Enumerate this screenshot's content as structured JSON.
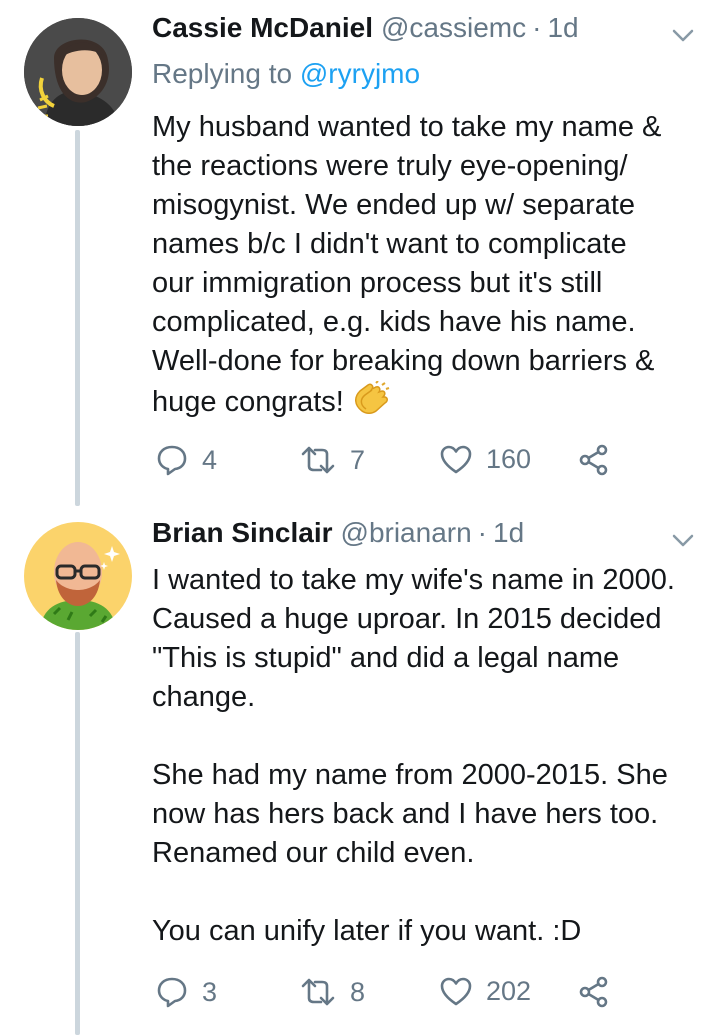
{
  "tweets": [
    {
      "name": "Cassie McDaniel",
      "handle": "@cassiemc",
      "separator": "·",
      "age": "1d",
      "replying_prefix": "Replying to",
      "replying_to": "@ryryjmo",
      "body": "My husband wanted to take my name &\nthe reactions were truly eye-opening/\nmisogynist. We ended up w/ separate\nnames b/c I didn't want to complicate\nour immigration process but it's still\ncomplicated, e.g. kids have his name.\nWell-done for breaking down barriers &\nhuge congrats!",
      "emoji": "clapping-hands-emoji",
      "replies": "4",
      "retweets": "7",
      "likes": "160"
    },
    {
      "name": "Brian Sinclair",
      "handle": "@brianarn",
      "separator": "·",
      "age": "1d",
      "body": "I wanted to take my wife's name in 2000.\nCaused a huge uproar. In 2015 decided\n\"This is stupid\" and did a legal name\nchange.\n\nShe had my name from 2000-2015. She\nnow has hers back and I have hers too.\nRenamed our child even.\n\nYou can unify later if you want. :D",
      "replies": "3",
      "retweets": "8",
      "likes": "202"
    }
  ],
  "icons": {
    "reply": "reply-icon",
    "retweet": "retweet-icon",
    "like": "heart-icon",
    "share": "share-icon",
    "menu": "chevron-down-icon"
  },
  "colors": {
    "text": "#14171a",
    "muted": "#657786",
    "link": "#1da1f2",
    "thread_line": "#ccd6dd"
  }
}
